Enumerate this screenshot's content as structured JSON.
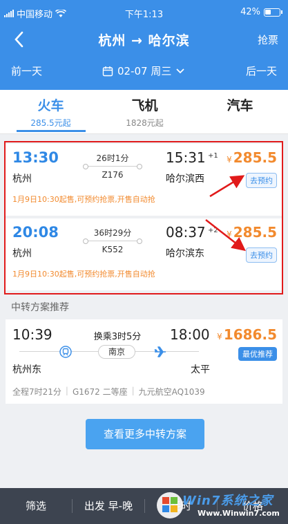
{
  "status": {
    "carrier": "中国移动",
    "time": "下午1:13",
    "battery": "42%"
  },
  "nav": {
    "title": "杭州 → 哈尔滨",
    "grab": "抢票"
  },
  "datebar": {
    "prev": "前一天",
    "date": "02-07 周三",
    "next": "后一天"
  },
  "tabs": [
    {
      "name": "火车",
      "price": "285.5元起"
    },
    {
      "name": "飞机",
      "price": "1828元起"
    },
    {
      "name": "汽车",
      "price": ""
    }
  ],
  "trains": [
    {
      "dep": "13:30",
      "from": "杭州",
      "duration": "26时1分",
      "no": "Z176",
      "arr": "15:31",
      "plus": "+1",
      "to": "哈尔滨西",
      "yen": "¥",
      "price": "285.5",
      "badge": "去预约",
      "note": "1月9日10:30起售,可预约抢票,开售自动抢"
    },
    {
      "dep": "20:08",
      "from": "杭州",
      "duration": "36时29分",
      "no": "K552",
      "arr": "08:37",
      "plus": "+2",
      "to": "哈尔滨东",
      "yen": "¥",
      "price": "285.5",
      "badge": "去预约",
      "note": "1月9日10:30起售,可预约抢票,开售自动抢"
    }
  ],
  "section_title": "中转方案推荐",
  "transfer": {
    "dep": "10:39",
    "arr": "18:00",
    "change": "换乘3时5分",
    "via": "南京",
    "from": "杭州东",
    "to": "太平",
    "yen": "¥",
    "price": "1686.5",
    "best": "最优推荐",
    "detail": [
      "全程7时21分",
      "G1672 二等座",
      "九元航空AQ1039"
    ]
  },
  "more_button": "查看更多中转方案",
  "bottom": {
    "filter": "筛选",
    "depart": "出发 早-晚",
    "duration": "耗时",
    "price": "价格"
  },
  "watermark": {
    "text": "Win7系统之家",
    "url": "Www.Winwin7.com"
  },
  "colors": {
    "primary": "#3b8fe8",
    "price": "#f28a2e",
    "highlight": "#e11a1a"
  }
}
